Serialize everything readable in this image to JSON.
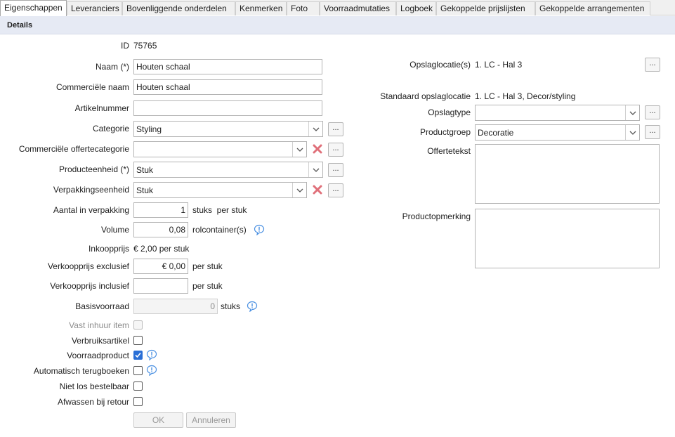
{
  "tabs": [
    {
      "label": "Eigenschappen",
      "active": true
    },
    {
      "label": "Leveranciers",
      "active": false
    },
    {
      "label": "Bovenliggende onderdelen",
      "active": false
    },
    {
      "label": "Kenmerken",
      "active": false
    },
    {
      "label": "Foto",
      "active": false
    },
    {
      "label": "Voorraadmutaties",
      "active": false
    },
    {
      "label": "Logboek",
      "active": false
    },
    {
      "label": "Gekoppelde prijslijsten",
      "active": false
    },
    {
      "label": "Gekoppelde arrangementen",
      "active": false
    }
  ],
  "section_title": "Details",
  "left": {
    "id": {
      "label": "ID",
      "value": "75765"
    },
    "naam": {
      "label": "Naam (*)",
      "value": "Houten schaal"
    },
    "commerciele_naam": {
      "label": "Commerciële naam",
      "value": "Houten schaal"
    },
    "artikelnummer": {
      "label": "Artikelnummer",
      "value": ""
    },
    "categorie": {
      "label": "Categorie",
      "value": "Styling"
    },
    "commerciele_offertecategorie": {
      "label": "Commerciële offertecategorie",
      "value": ""
    },
    "producteenheid": {
      "label": "Producteenheid (*)",
      "value": "Stuk"
    },
    "verpakkingseenheid": {
      "label": "Verpakkingseenheid",
      "value": "Stuk"
    },
    "aantal_in_verpakking": {
      "label": "Aantal in verpakking",
      "value": "1",
      "unit": "stuks  per stuk"
    },
    "volume": {
      "label": "Volume",
      "value": "0,08",
      "unit": "rolcontainer(s)"
    },
    "inkoopprijs": {
      "label": "Inkoopprijs",
      "value": "€ 2,00 per stuk"
    },
    "verkoopprijs_exclusief": {
      "label": "Verkoopprijs exclusief",
      "value": "€ 0,00",
      "unit": "per stuk"
    },
    "verkoopprijs_inclusief": {
      "label": "Verkoopprijs inclusief",
      "value": "",
      "unit": "per stuk"
    },
    "basisvoorraad": {
      "label": "Basisvoorraad",
      "value": "0",
      "unit": "stuks"
    },
    "checkboxes": {
      "vast_inhuur_item": {
        "label": "Vast inhuur item",
        "checked": false,
        "disabled": true
      },
      "verbruiksartikel": {
        "label": "Verbruiksartikel",
        "checked": false,
        "disabled": false
      },
      "voorraadproduct": {
        "label": "Voorraadproduct",
        "checked": true,
        "disabled": false
      },
      "automatisch_terugboeken": {
        "label": "Automatisch terugboeken",
        "checked": false,
        "disabled": false
      },
      "niet_los_bestelbaar": {
        "label": "Niet los bestelbaar",
        "checked": false,
        "disabled": false
      },
      "afwassen_bij_retour": {
        "label": "Afwassen bij retour",
        "checked": false,
        "disabled": false
      }
    }
  },
  "right": {
    "opslaglocaties": {
      "label": "Opslaglocatie(s)",
      "value": "1. LC - Hal 3"
    },
    "standaard_opslaglocatie": {
      "label": "Standaard opslaglocatie",
      "value": "1. LC - Hal 3, Decor/styling"
    },
    "opslagtype": {
      "label": "Opslagtype",
      "value": ""
    },
    "productgroep": {
      "label": "Productgroep",
      "value": "Decoratie"
    },
    "offertetekst": {
      "label": "Offertetekst",
      "value": ""
    },
    "productopmerking": {
      "label": "Productopmerking",
      "value": ""
    }
  },
  "buttons": {
    "ellipsis": "...",
    "ok": "OK",
    "annuleren": "Annuleren"
  },
  "icons": {
    "remove": "remove-x-icon",
    "info": "info-icon",
    "dropdown": "chevron-down-icon",
    "check": "check-icon"
  },
  "colors": {
    "section_bg": "#e6eaf4",
    "remove_icon": "#e0707a",
    "info_icon": "#4a90e2",
    "checkbox_checked": "#2a6fd6"
  }
}
